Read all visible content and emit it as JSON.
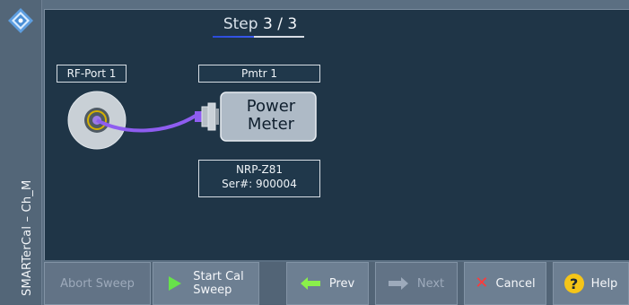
{
  "window": {
    "vertical_title": "SMARTerCal – Ch_M",
    "logo_icon": "rs-diamond-logo"
  },
  "panel": {
    "step_label": "Step",
    "step_value": "3 / 3",
    "rf_port_label": "RF-Port 1",
    "pmtr_label": "Pmtr 1",
    "power_meter_line1": "Power",
    "power_meter_line2": "Meter",
    "sensor_model": "NRP-Z81",
    "sensor_serial": "Ser#: 900004"
  },
  "buttons": {
    "abort": "Abort Sweep",
    "start_line1": "Start Cal",
    "start_line2": "Sweep",
    "prev": "Prev",
    "next": "Next",
    "cancel": "Cancel",
    "help": "Help"
  },
  "colors": {
    "cable": "#8e5df0",
    "prev_arrow": "#8af04a",
    "start_play": "#67e24a",
    "cancel_x": "#ff3a3a",
    "help_circle": "#f5c518"
  }
}
